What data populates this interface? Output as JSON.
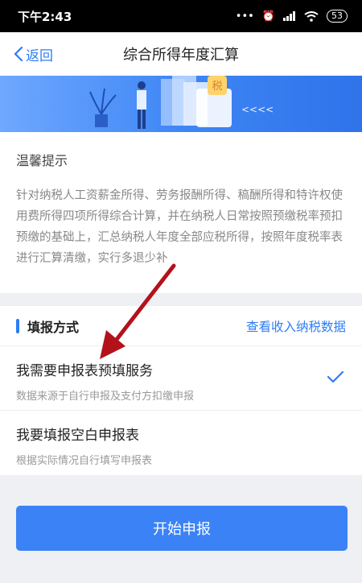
{
  "status": {
    "time": "下午2:43",
    "battery": "53"
  },
  "nav": {
    "back_label": "返回",
    "title": "综合所得年度汇算"
  },
  "banner": {
    "tax_char": "税",
    "arrows": "<<<<"
  },
  "notice": {
    "title": "温馨提示",
    "body": "针对纳税人工资薪金所得、劳务报酬所得、稿酬所得和特许权使用费所得四项所得综合计算，并在纳税人日常按照预缴税率预扣预缴的基础上，汇总纳税人年度全部应税所得，按照年度税率表进行汇算清缴，实行多退少补"
  },
  "method": {
    "title": "填报方式",
    "view_link": "查看收入纳税数据",
    "options": [
      {
        "title": "我需要申报表预填服务",
        "subtitle": "数据来源于自行申报及支付方扣缴申报",
        "selected": true
      },
      {
        "title": "我要填报空白申报表",
        "subtitle": "根据实际情况自行填写申报表",
        "selected": false
      }
    ]
  },
  "start_button": "开始申报",
  "colors": {
    "accent": "#2e7cf6",
    "button": "#3b82f6",
    "annotation": "#b3121b"
  }
}
